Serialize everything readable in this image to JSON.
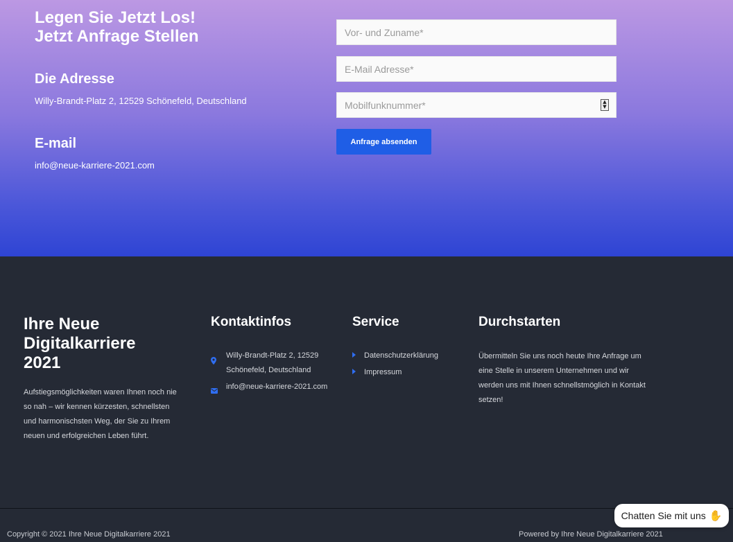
{
  "hero": {
    "title_line1": "Legen Sie Jetzt Los!",
    "title_line2": "Jetzt Anfrage Stellen",
    "address_heading": "Die Adresse",
    "address_text": "Willy-Brandt-Platz 2, 12529 Schönefeld, Deutschland",
    "email_heading": "E-mail",
    "email_text": "info@neue-karriere-2021.com"
  },
  "form": {
    "name_placeholder": "Vor- und Zuname*",
    "email_placeholder": "E-Mail Adresse*",
    "phone_placeholder": "Mobilfunknummer*",
    "submit_label": "Anfrage absenden",
    "spinner_up": "▲",
    "spinner_down": "▼"
  },
  "footer": {
    "brand_line1": "Ihre Neue",
    "brand_line2": "Digitalkarriere",
    "brand_line3": "2021",
    "brand_description": "Aufstiegsmöglichkeiten waren Ihnen noch nie so nah – wir kennen kürzesten, schnellsten und harmonischsten Weg, der Sie zu Ihrem neuen und erfolgreichen Leben führt.",
    "contact_heading": "Kontaktinfos",
    "contact_address_line1": "Willy-Brandt-Platz 2, 12529",
    "contact_address_line2": "Schönefeld, Deutschland",
    "contact_email": "info@neue-karriere-2021.com",
    "contact_address_icon": "map-marker-icon",
    "contact_email_icon": "envelope-icon",
    "service_heading": "Service",
    "service_items": [
      "Datenschutzerklärung",
      "Impressum"
    ],
    "service_icon": "caret-right-icon",
    "durchstarten_heading": "Durchstarten",
    "durchstarten_text": "Übermitteln Sie uns noch heute Ihre Anfrage um eine Stelle in unserem Unternehmen und wir werden uns mit Ihnen schnellstmöglich in Kontakt setzen!",
    "copyright": "Copyright © 2021 Ihre Neue Digitalkarriere 2021",
    "powered": "Powered by Ihre Neue Digitalkarriere 2021"
  },
  "chat": {
    "label": "Chatten Sie mit uns",
    "icon": "waving-hand-icon",
    "emoji": "✋"
  },
  "colors": {
    "accent": "#1f5ee6",
    "footer_bg": "#252a35"
  }
}
